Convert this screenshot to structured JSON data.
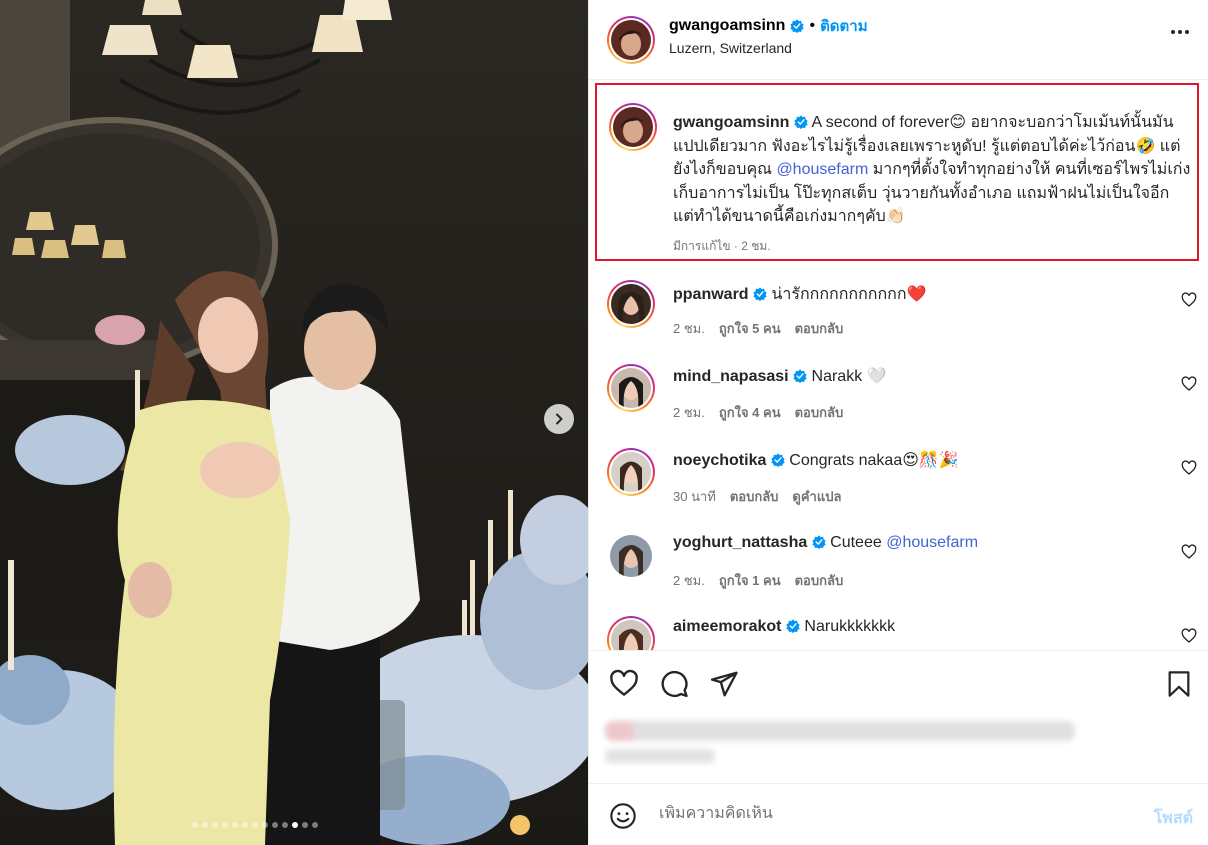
{
  "header": {
    "username": "gwangoamsinn",
    "separator": "•",
    "follow_label": "ติดตาม",
    "location": "Luzern, Switzerland"
  },
  "caption": {
    "username": "gwangoamsinn",
    "text_1": "A second of forever😊 อยากจะบอกว่าโมเม้นท์นั้นมันแปปเดียวมาก ฟังอะไรไม่รู้เรื่องเลยเพราะหูดับ! รู้แต่ตอบได้ค่ะไว้ก่อน🤣 แต่ยังไงก็ขอบคุณ ",
    "mention": "@housefarm",
    "text_2": " มากๆที่ตั้งใจทำทุกอย่างให้ คนที่เซอร์ไพรไม่เก่ง เก็บอาการไม่เป็น โป๊ะทุกสเต็บ วุ่นวายกันทั้งอำเภอ แถมฟ้าฝนไม่เป็นใจอีก แต่ทำได้ขนาดนี้คือเก่งมากๆคับ👏🏻",
    "meta": "มีการแก้ไข · 2 ชม."
  },
  "comments": [
    {
      "username": "ppanward",
      "text": "น่ารักกกกกกกกกกก❤️",
      "time": "2 ชม.",
      "likes": "ถูกใจ 5 คน",
      "reply": "ตอบกลับ"
    },
    {
      "username": "mind_napasasi",
      "text": "Narakk 🤍",
      "time": "2 ชม.",
      "likes": "ถูกใจ 4 คน",
      "reply": "ตอบกลับ"
    },
    {
      "username": "noeychotika",
      "text": "Congrats nakaa😍🎊🎉",
      "time": "30 นาที",
      "reply": "ตอบกลับ",
      "translate": "ดูคำแปล"
    },
    {
      "username": "yoghurt_nattasha",
      "text": "Cuteee ",
      "mention": "@housefarm",
      "time": "2 ชม.",
      "likes": "ถูกใจ 1 คน",
      "reply": "ตอบกลับ"
    },
    {
      "username": "aimeemorakot",
      "text": "Narukkkkkkk"
    }
  ],
  "composer": {
    "placeholder": "เพิ่มความคิดเห็น",
    "post_label": "โพสต์"
  },
  "carousel": {
    "total": 13,
    "active_index": 10
  },
  "icons": {
    "like": "heart-icon",
    "comment": "comment-icon",
    "share": "send-icon",
    "save": "bookmark-icon",
    "more": "more-icon",
    "emoji": "emoji-icon",
    "next": "chevron-right-icon"
  },
  "colors": {
    "accent": "#0095f6",
    "mention": "#4263d4",
    "highlight_border": "#e0162b",
    "muted": "#737373"
  }
}
